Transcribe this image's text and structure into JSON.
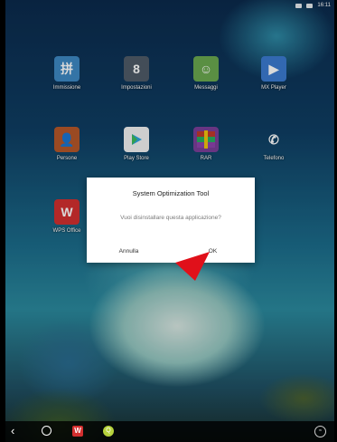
{
  "status_bar": {
    "time": "16:11"
  },
  "apps": [
    {
      "id": "immissione",
      "label": "Immissione",
      "icon": "keyboard-icon",
      "glyph": "拼"
    },
    {
      "id": "impostazioni",
      "label": "Impostazioni",
      "icon": "settings-icon",
      "glyph": "8"
    },
    {
      "id": "messaggi",
      "label": "Messaggi",
      "icon": "message-icon",
      "glyph": "☺"
    },
    {
      "id": "mxplayer",
      "label": "MX Player",
      "icon": "play-icon",
      "glyph": "▶"
    },
    {
      "id": "persone",
      "label": "Persone",
      "icon": "contacts-icon",
      "glyph": "👤"
    },
    {
      "id": "playstore",
      "label": "Play Store",
      "icon": "play-store-icon",
      "glyph": "▶"
    },
    {
      "id": "rar",
      "label": "RAR",
      "icon": "rar-archive-icon",
      "glyph": "≡"
    },
    {
      "id": "telefono",
      "label": "Telefono",
      "icon": "phone-icon",
      "glyph": "✆"
    },
    {
      "id": "wps",
      "label": "WPS Office",
      "icon": "wps-office-icon",
      "glyph": "W"
    }
  ],
  "dialog": {
    "title": "System Optimization Tool",
    "message": "Vuoi disinstallare questa applicazione?",
    "cancel_label": "Annulla",
    "ok_label": "OK"
  },
  "navbar": {
    "back_glyph": "‹",
    "wps_glyph": "W",
    "search_glyph": "Q",
    "right_glyph": "≈"
  },
  "colors": {
    "arrow": "#e0101a",
    "wps": "#d32f2f"
  }
}
